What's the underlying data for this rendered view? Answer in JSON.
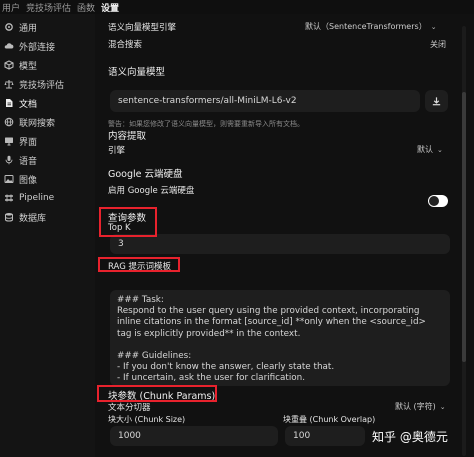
{
  "topnav": {
    "items": [
      "用户",
      "竞技场评估",
      "函数",
      "设置"
    ]
  },
  "sidebar": {
    "items": [
      {
        "label": "通用",
        "icon": "gear-icon"
      },
      {
        "label": "外部连接",
        "icon": "cloud-icon"
      },
      {
        "label": "模型",
        "icon": "cube-icon"
      },
      {
        "label": "竞技场评估",
        "icon": "scale-icon"
      },
      {
        "label": "文档",
        "icon": "document-icon"
      },
      {
        "label": "联网搜索",
        "icon": "globe-icon"
      },
      {
        "label": "界面",
        "icon": "monitor-icon"
      },
      {
        "label": "语音",
        "icon": "microphone-icon"
      },
      {
        "label": "图像",
        "icon": "image-icon"
      },
      {
        "label": "Pipeline",
        "icon": "pipeline-icon"
      },
      {
        "label": "数据库",
        "icon": "database-icon"
      }
    ],
    "active_index": 4
  },
  "settings": {
    "embedding_engine_label": "语义向量模型引擎",
    "embedding_engine_value": "默认（SentenceTransformers）",
    "hybrid_search_label": "混合搜索",
    "hybrid_search_value": "关闭",
    "embedding_model_title": "语义向量模型",
    "embedding_model_value": "sentence-transformers/all-MiniLM-L6-v2",
    "embedding_model_warning": "警告：如果您修改了语义向量模型，则需要重新导入所有文档。",
    "content_extraction_title": "内容提取",
    "engine_label": "引擎",
    "engine_value": "默认",
    "gdrive_title": "Google 云端硬盘",
    "gdrive_enable_label": "启用 Google 云端硬盘",
    "query_params_title": "查询参数",
    "top_k_label": "Top K",
    "top_k_value": "3",
    "rag_template_label": "RAG 提示词模板",
    "rag_template_text": "### Task:\nRespond to the user query using the provided context, incorporating inline citations in the format [source_id] **only when the <source_id> tag is explicitly provided** in the context.\n\n### Guidelines:\n- If you don't know the answer, clearly state that.\n- If uncertain, ask the user for clarification.",
    "chunk_params_title": "块参数 (Chunk Params)",
    "text_splitter_label": "文本分切器",
    "text_splitter_value": "默认 (字符)",
    "chunk_size_label": "块大小 (Chunk Size)",
    "chunk_size_value": "1000",
    "chunk_overlap_label": "块重叠 (Chunk Overlap)",
    "chunk_overlap_value": "100"
  },
  "watermark": {
    "text": "知乎 @奥德元"
  },
  "colors": {
    "highlight": "#e8222d",
    "background": "#111111",
    "field": "#1e1e1e"
  }
}
